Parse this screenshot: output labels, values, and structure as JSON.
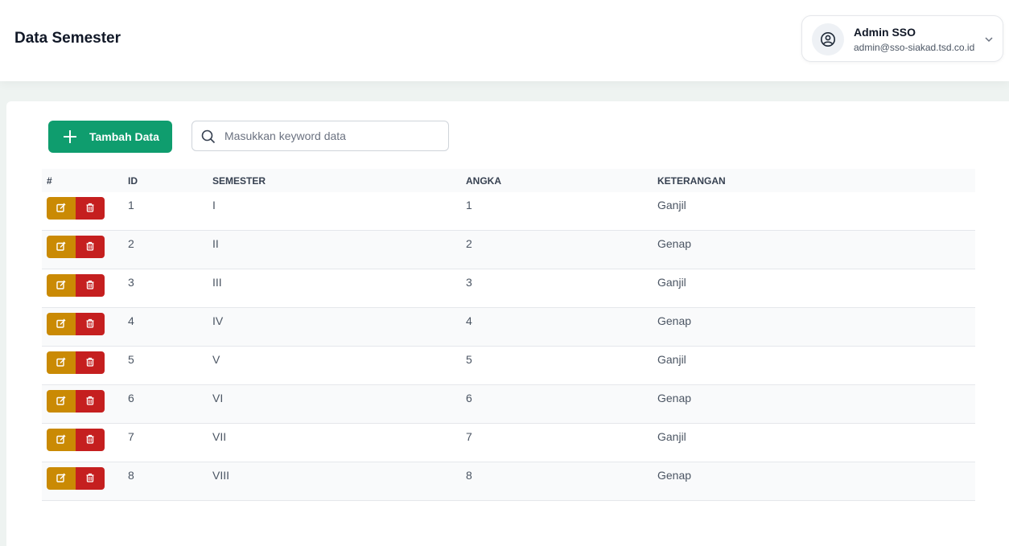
{
  "header": {
    "title": "Data Semester",
    "user": {
      "name": "Admin SSO",
      "email": "admin@sso-siakad.tsd.co.id"
    }
  },
  "toolbar": {
    "add_label": "Tambah Data",
    "search_placeholder": "Masukkan keyword data",
    "search_value": ""
  },
  "table": {
    "columns": [
      "#",
      "ID",
      "SEMESTER",
      "ANGKA",
      "KETERANGAN"
    ],
    "rows": [
      {
        "id": "1",
        "semester": "I",
        "angka": "1",
        "keterangan": "Ganjil"
      },
      {
        "id": "2",
        "semester": "II",
        "angka": "2",
        "keterangan": "Genap"
      },
      {
        "id": "3",
        "semester": "III",
        "angka": "3",
        "keterangan": "Ganjil"
      },
      {
        "id": "4",
        "semester": "IV",
        "angka": "4",
        "keterangan": "Genap"
      },
      {
        "id": "5",
        "semester": "V",
        "angka": "5",
        "keterangan": "Ganjil"
      },
      {
        "id": "6",
        "semester": "VI",
        "angka": "6",
        "keterangan": "Genap"
      },
      {
        "id": "7",
        "semester": "VII",
        "angka": "7",
        "keterangan": "Ganjil"
      },
      {
        "id": "8",
        "semester": "VIII",
        "angka": "8",
        "keterangan": "Genap"
      }
    ]
  },
  "icons": {
    "add": "plus-icon",
    "search": "search-icon",
    "user": "user-circle-icon",
    "dropdown": "chevron-down-icon",
    "edit": "edit-icon",
    "delete": "trash-icon"
  },
  "colors": {
    "primary": "#0f9d6e",
    "edit": "#ca8a04",
    "delete": "#c51f1f"
  }
}
